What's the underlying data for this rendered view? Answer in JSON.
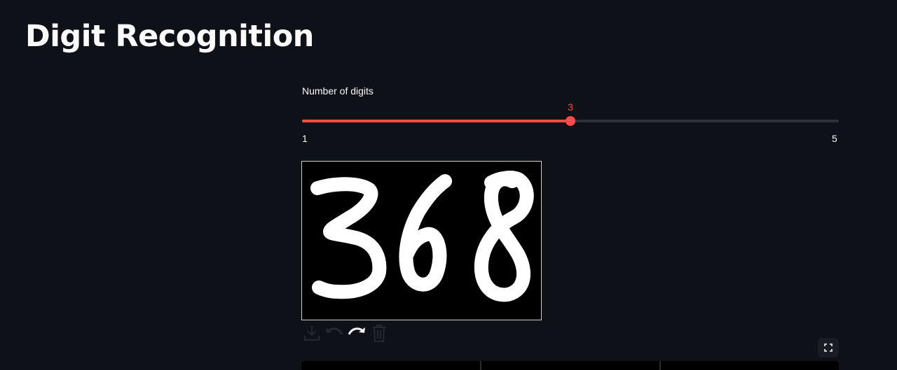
{
  "page": {
    "title": "Digit Recognition"
  },
  "slider": {
    "label": "Number of digits",
    "min": "1",
    "max": "5",
    "value": "3",
    "value_number": 3,
    "min_number": 1,
    "max_number": 5
  },
  "canvas": {
    "drawn_digits": "368",
    "stroke_color": "#ffffff",
    "background_color": "#000000"
  },
  "toolbar": {
    "icons": [
      "download-icon",
      "undo-icon",
      "redo-icon",
      "trash-icon"
    ]
  },
  "colors": {
    "accent": "#ff4b4b",
    "background": "#0e1117",
    "track": "#2e3039"
  }
}
